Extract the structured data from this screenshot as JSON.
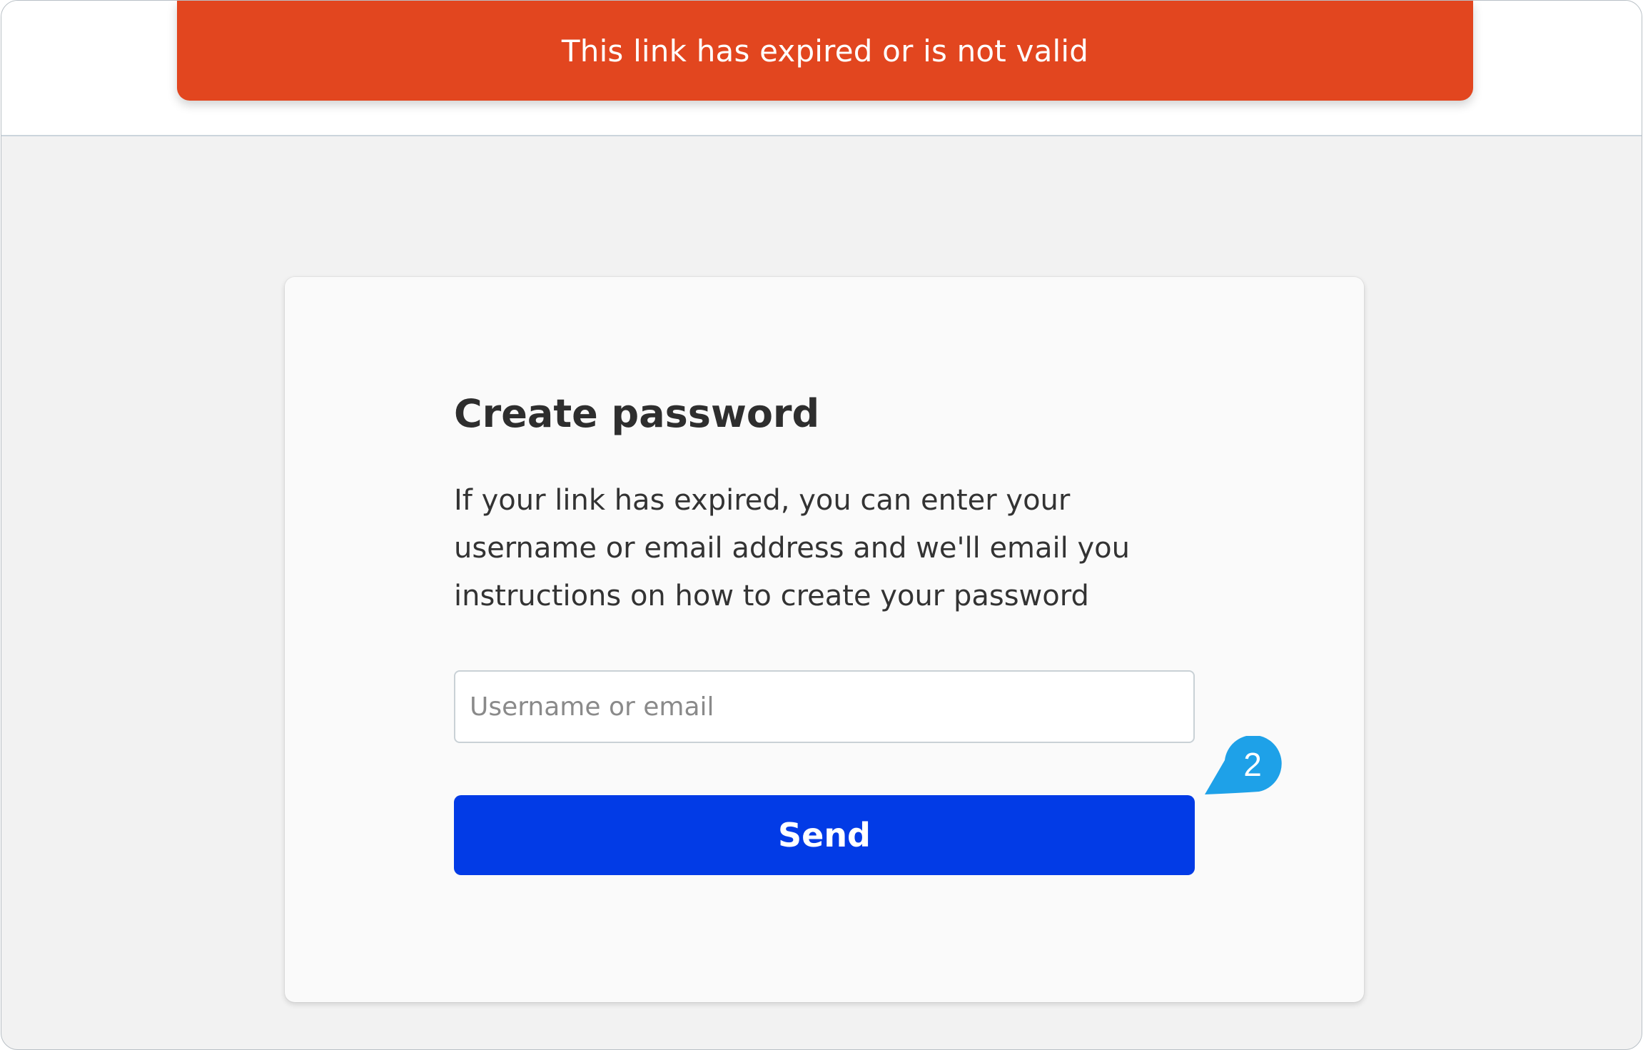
{
  "alert": {
    "message": "This link has expired or is not valid",
    "color": "#e2461f"
  },
  "form": {
    "title": "Create password",
    "description": "If your link has expired, you can enter your username or email address and we'll email you instructions on how to create your password",
    "username_field": {
      "value": "",
      "placeholder": "Username or email"
    },
    "send_label": "Send",
    "send_color": "#023be6"
  },
  "annotation": {
    "step_number": "2",
    "color": "#1ea1e8"
  }
}
